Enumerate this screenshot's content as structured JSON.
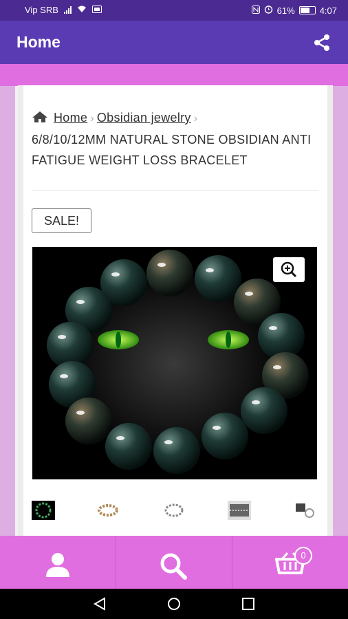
{
  "status_bar": {
    "carrier": "Vip SRB",
    "battery": "61%",
    "time": "4:07"
  },
  "app_bar": {
    "title": "Home"
  },
  "breadcrumb": {
    "home": "Home",
    "category": "Obsidian jewelry",
    "current": "6/8/10/12MM NATURAL STONE OBSIDIAN ANTI FATIGUE WEIGHT LOSS BRACELET"
  },
  "product": {
    "sale_badge": "SALE!"
  },
  "cart": {
    "count": "0"
  },
  "colors": {
    "status_bar": "#4b2a91",
    "app_bar": "#5b3bb4",
    "accent_pink": "#e16ee0"
  }
}
